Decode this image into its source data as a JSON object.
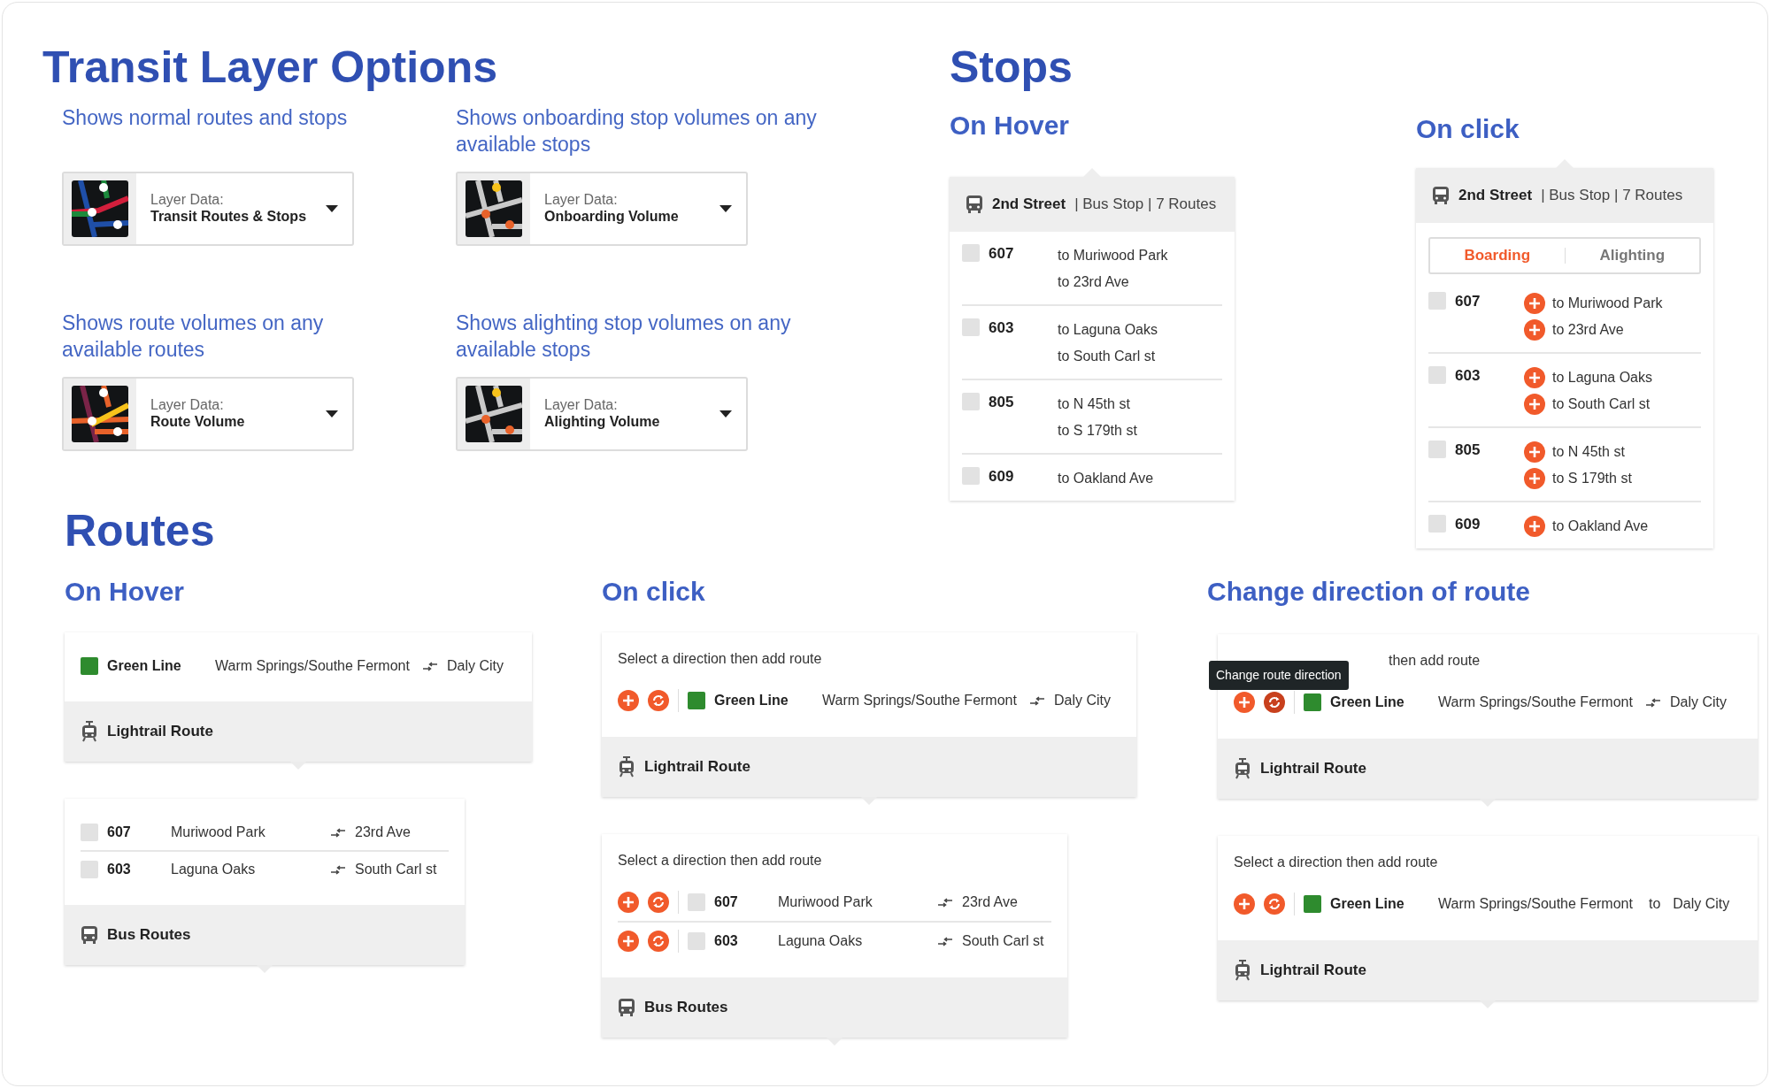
{
  "layer_options": {
    "title": "Transit Layer Options",
    "options": [
      {
        "description": "Shows normal routes and stops",
        "label": "Layer Data:",
        "value": "Transit Routes & Stops",
        "kind": "routes"
      },
      {
        "description": "Shows onboarding stop volumes on any available stops",
        "label": "Layer Data:",
        "value": "Onboarding Volume",
        "kind": "stop_volume"
      },
      {
        "description": "Shows route volumes on any available routes",
        "label": "Layer Data:",
        "value": "Route Volume",
        "kind": "route_volume"
      },
      {
        "description": "Shows alighting stop volumes on any available stops",
        "label": "Layer Data:",
        "value": "Alighting Volume",
        "kind": "stop_volume"
      }
    ]
  },
  "stops": {
    "title": "Stops",
    "views": [
      {
        "heading": "On Hover",
        "stop": "2nd Street",
        "meta": "| Bus Stop | 7 Routes",
        "add_buttons": false,
        "routes": [
          {
            "number": "607",
            "checked": false,
            "destinations": [
              "to Muriwood Park",
              "to 23rd Ave"
            ]
          },
          {
            "number": "603",
            "checked": false,
            "destinations": [
              "to Laguna Oaks",
              "to South Carl st"
            ]
          },
          {
            "number": "805",
            "checked": false,
            "destinations": [
              "to N 45th st",
              "to S 179th st"
            ]
          },
          {
            "number": "609",
            "checked": false,
            "destinations": [
              "to Oakland Ave"
            ]
          }
        ]
      },
      {
        "heading": "On click",
        "stop": "2nd Street",
        "meta": "| Bus Stop | 7 Routes",
        "add_buttons": true,
        "tabs": [
          {
            "label": "Boarding",
            "selected": true
          },
          {
            "label": "Alighting",
            "selected": false
          }
        ],
        "routes": [
          {
            "number": "607",
            "checked": false,
            "destinations": [
              "to Muriwood Park",
              "to 23rd Ave"
            ]
          },
          {
            "number": "603",
            "checked": false,
            "destinations": [
              "to Laguna Oaks",
              "to South Carl st"
            ]
          },
          {
            "number": "805",
            "checked": false,
            "destinations": [
              "to N 45th st",
              "to S 179th st"
            ]
          },
          {
            "number": "609",
            "checked": false,
            "destinations": [
              "to Oakland Ave"
            ]
          }
        ]
      }
    ]
  },
  "routes": {
    "title": "Routes",
    "panels": [
      {
        "heading": "On Hover",
        "cards": [
          {
            "rows": [
              {
                "kind": "line",
                "name": "Green Line",
                "color": "#2e8b2e",
                "from": "Warm Springs/Southe Fermont",
                "to": "Daly City",
                "actions": false
              }
            ],
            "footer": {
              "kind": "lightrail",
              "label": "Lightrail Route"
            }
          },
          {
            "rows": [
              {
                "kind": "bus",
                "name": "607",
                "color": "#e2e2e2",
                "from": "Muriwood Park",
                "to": "23rd Ave",
                "actions": false
              },
              {
                "kind": "bus",
                "name": "603",
                "color": "#e2e2e2",
                "from": "Laguna Oaks",
                "to": "South Carl st",
                "actions": false
              }
            ],
            "footer": {
              "kind": "bus",
              "label": "Bus Routes"
            }
          }
        ]
      },
      {
        "heading": "On click",
        "cards": [
          {
            "prompt": "Select a direction then add route",
            "rows": [
              {
                "kind": "line",
                "name": "Green Line",
                "color": "#2e8b2e",
                "from": "Warm Springs/Southe Fermont",
                "to": "Daly City",
                "actions": true,
                "reverse_hovered": false
              }
            ],
            "footer": {
              "kind": "lightrail",
              "label": "Lightrail Route"
            }
          },
          {
            "prompt": "Select a direction then add route",
            "rows": [
              {
                "kind": "bus",
                "name": "607",
                "color": "#e2e2e2",
                "from": "Muriwood Park",
                "to": "23rd Ave",
                "actions": true,
                "reverse_hovered": false
              },
              {
                "kind": "bus",
                "name": "603",
                "color": "#e2e2e2",
                "from": "Laguna Oaks",
                "to": "South Carl st",
                "actions": true,
                "reverse_hovered": false
              }
            ],
            "footer": {
              "kind": "bus",
              "label": "Bus Routes"
            }
          }
        ]
      },
      {
        "heading": "Change direction of route",
        "cards": [
          {
            "prompt": "then add route",
            "tooltip": "Change route direction",
            "rows": [
              {
                "kind": "line",
                "name": "Green Line",
                "color": "#2e8b2e",
                "from": "Warm Springs/Southe Fermont",
                "to": "Daly City",
                "actions": true,
                "reverse_hovered": true
              }
            ],
            "footer": {
              "kind": "lightrail",
              "label": "Lightrail Route"
            }
          },
          {
            "prompt": "Select a direction then add route",
            "rows": [
              {
                "kind": "line",
                "name": "Green Line",
                "color": "#2e8b2e",
                "from": "Warm Springs/Southe Fermont",
                "via": "to",
                "to": "Daly City",
                "actions": true,
                "reverse_hovered": false
              }
            ],
            "footer": {
              "kind": "lightrail",
              "label": "Lightrail Route"
            }
          }
        ]
      }
    ]
  }
}
